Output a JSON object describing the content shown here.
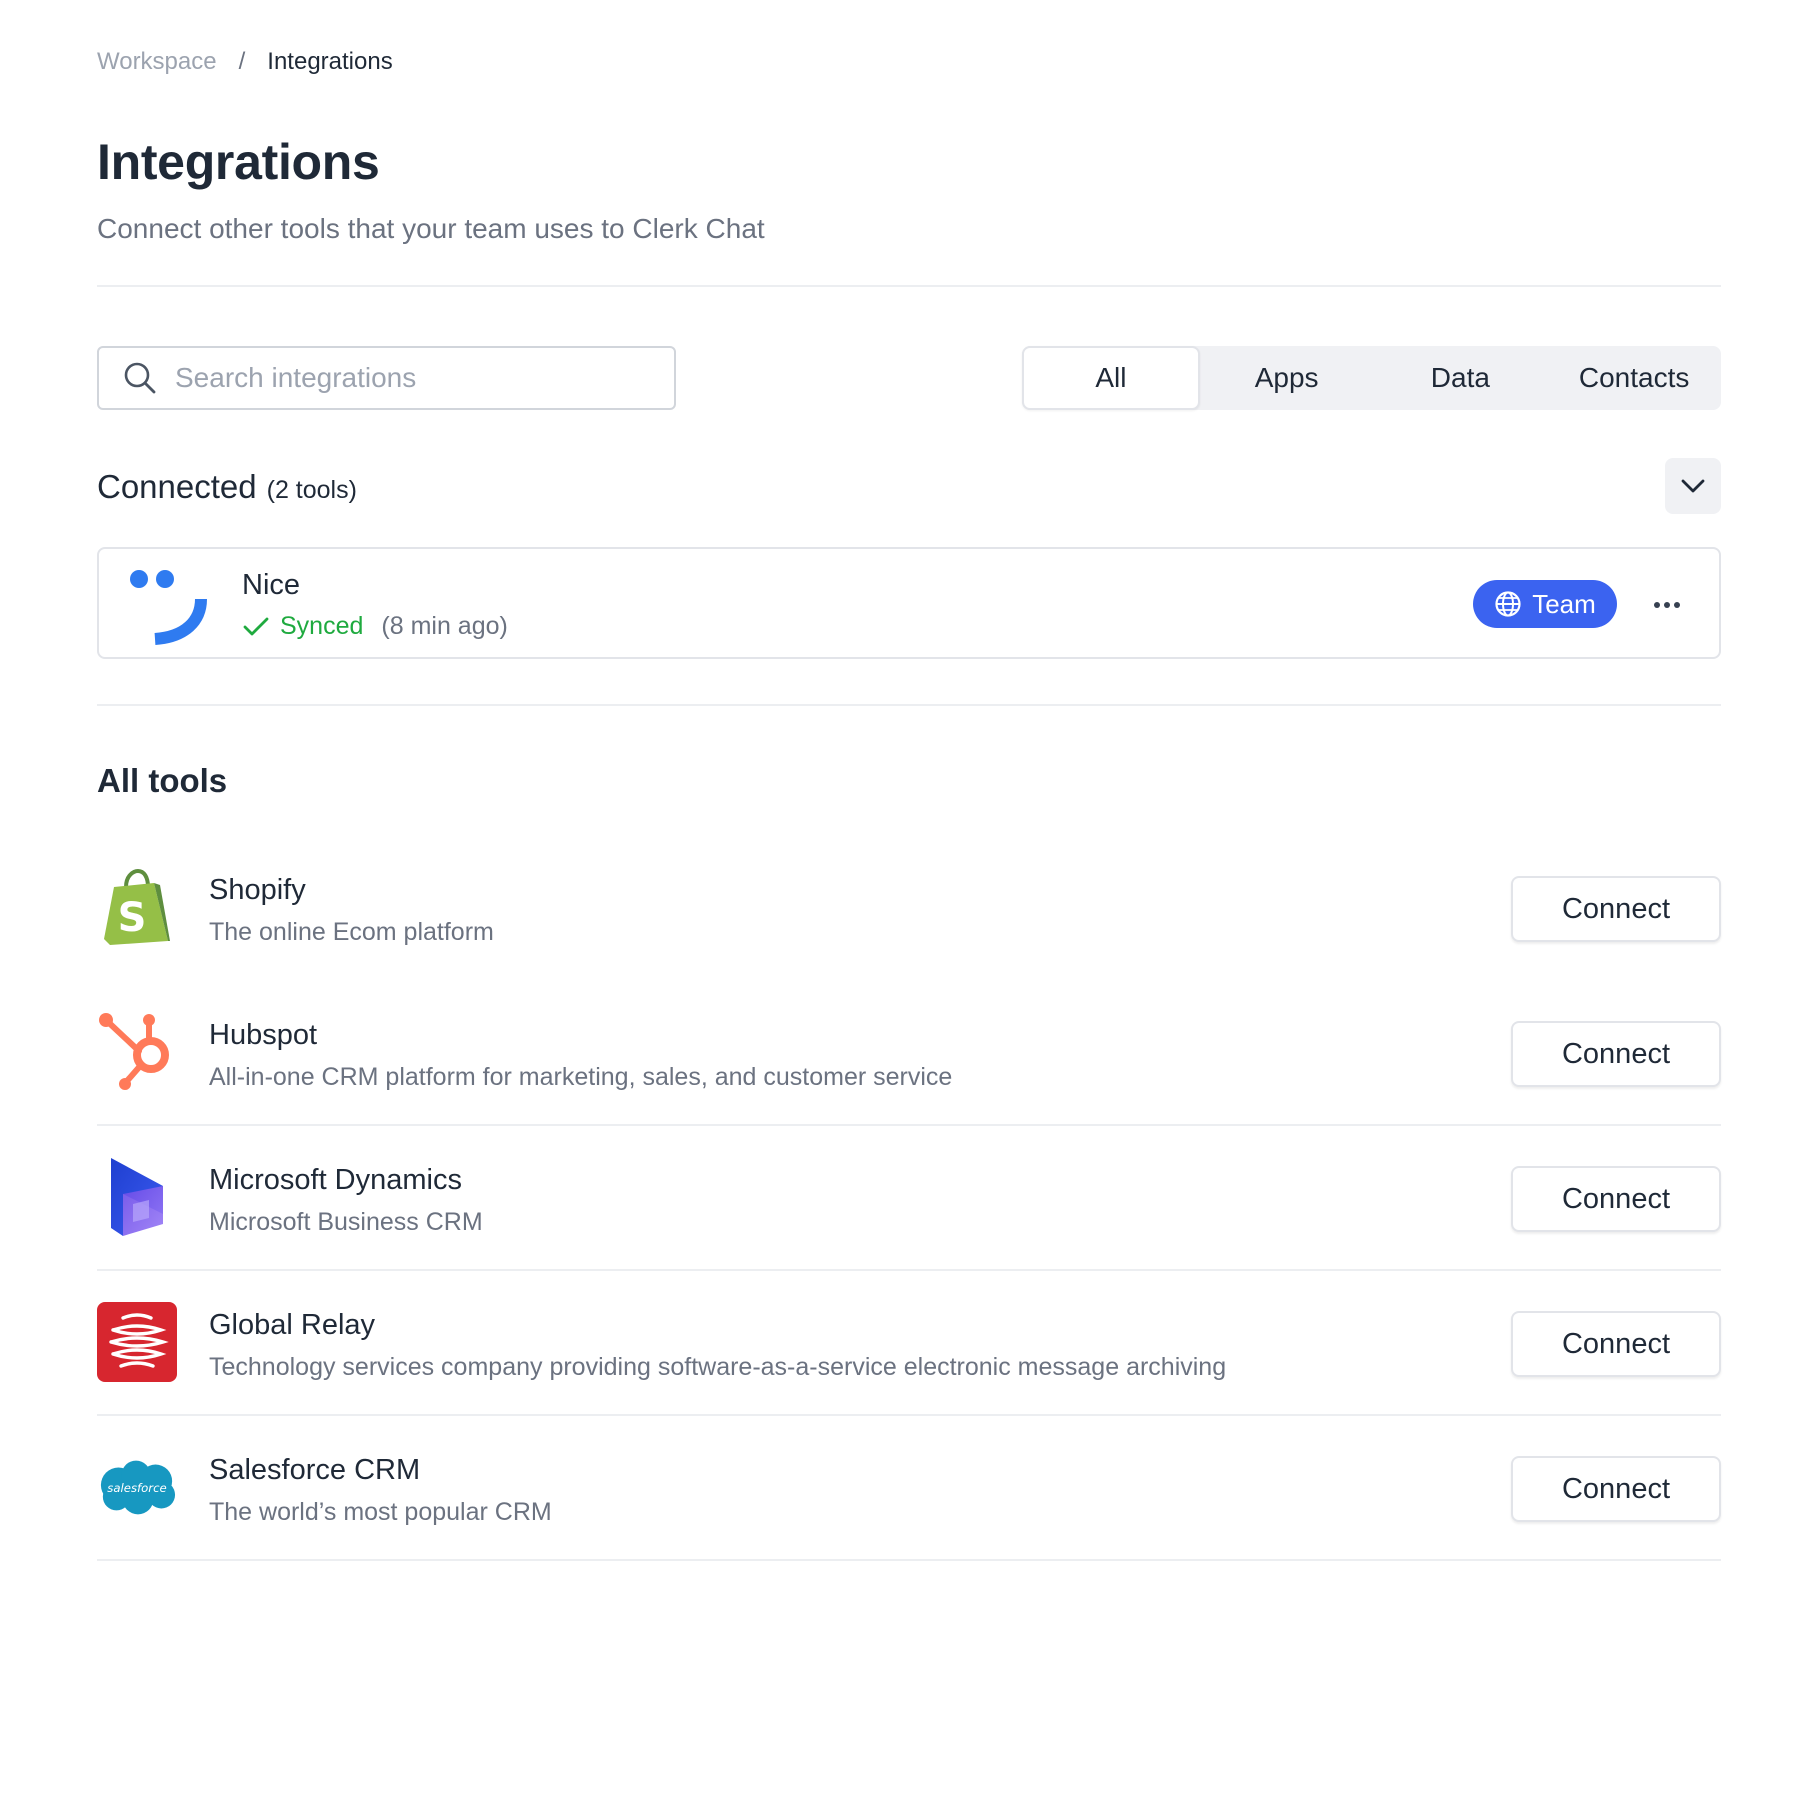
{
  "breadcrumb": {
    "root": "Workspace",
    "separator": "/",
    "current": "Integrations"
  },
  "header": {
    "title": "Integrations",
    "subtitle": "Connect other tools that your team uses to Clerk Chat"
  },
  "search": {
    "placeholder": "Search integrations",
    "value": ""
  },
  "tabs": [
    {
      "label": "All",
      "active": true
    },
    {
      "label": "Apps",
      "active": false
    },
    {
      "label": "Data",
      "active": false
    },
    {
      "label": "Contacts",
      "active": false
    }
  ],
  "connected": {
    "title": "Connected",
    "count_label": "(2 tools)",
    "items": [
      {
        "name": "Nice",
        "status": "Synced",
        "status_time": "(8 min ago)",
        "badge": "Team"
      }
    ]
  },
  "all_tools": {
    "title": "All tools",
    "connect_label": "Connect",
    "items": [
      {
        "name": "Shopify",
        "description": "The online Ecom platform",
        "icon": "shopify-icon"
      },
      {
        "name": "Hubspot",
        "description": "All-in-one CRM platform for marketing, sales, and customer service",
        "icon": "hubspot-icon"
      },
      {
        "name": "Microsoft Dynamics",
        "description": "Microsoft Business CRM",
        "icon": "microsoft-dynamics-icon"
      },
      {
        "name": "Global Relay",
        "description": "Technology services company providing software-as-a-service electronic message archiving",
        "icon": "global-relay-icon"
      },
      {
        "name": "Salesforce CRM",
        "description": "The world’s most popular CRM",
        "icon": "salesforce-icon",
        "logo_text": "salesforce"
      }
    ]
  },
  "colors": {
    "accent": "#3b63f0",
    "success": "#1faa3f",
    "nice_blue": "#2f7bf0",
    "shopify_green": "#95bf47",
    "hubspot_orange": "#ff7a59",
    "global_relay_red": "#d7262f",
    "salesforce_blue": "#1798c1"
  }
}
